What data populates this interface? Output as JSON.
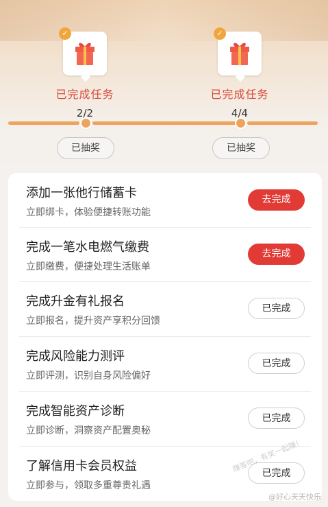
{
  "rewards": [
    {
      "status": "已完成任务",
      "count": "2/2",
      "claim_label": "已抽奖"
    },
    {
      "status": "已完成任务",
      "count": "4/4",
      "claim_label": "已抽奖"
    }
  ],
  "colors": {
    "accent": "#e23a35",
    "progress": "#eda55d",
    "badge": "#f1a63d"
  },
  "tasks": [
    {
      "title": "添加一张他行储蓄卡",
      "subtitle": "立即绑卡，体验便捷转账功能",
      "action": "去完成",
      "state": "todo"
    },
    {
      "title": "完成一笔水电燃气缴费",
      "subtitle": "立即缴费，便捷处理生活账单",
      "action": "去完成",
      "state": "todo"
    },
    {
      "title": "完成升金有礼报名",
      "subtitle": "立即报名，提升资产享积分回馈",
      "action": "已完成",
      "state": "done"
    },
    {
      "title": "完成风险能力测评",
      "subtitle": "立即评测，识别自身风险偏好",
      "action": "已完成",
      "state": "done"
    },
    {
      "title": "完成智能资产诊断",
      "subtitle": "立即诊断，洞察资产配置奥秘",
      "action": "已完成",
      "state": "done"
    },
    {
      "title": "了解信用卡会员权益",
      "subtitle": "立即参与，领取多重尊贵礼遇",
      "action": "已完成",
      "state": "done"
    }
  ],
  "watermark": "赚客吧，有奖一起赚！",
  "corner_text": "@好心天天快乐"
}
